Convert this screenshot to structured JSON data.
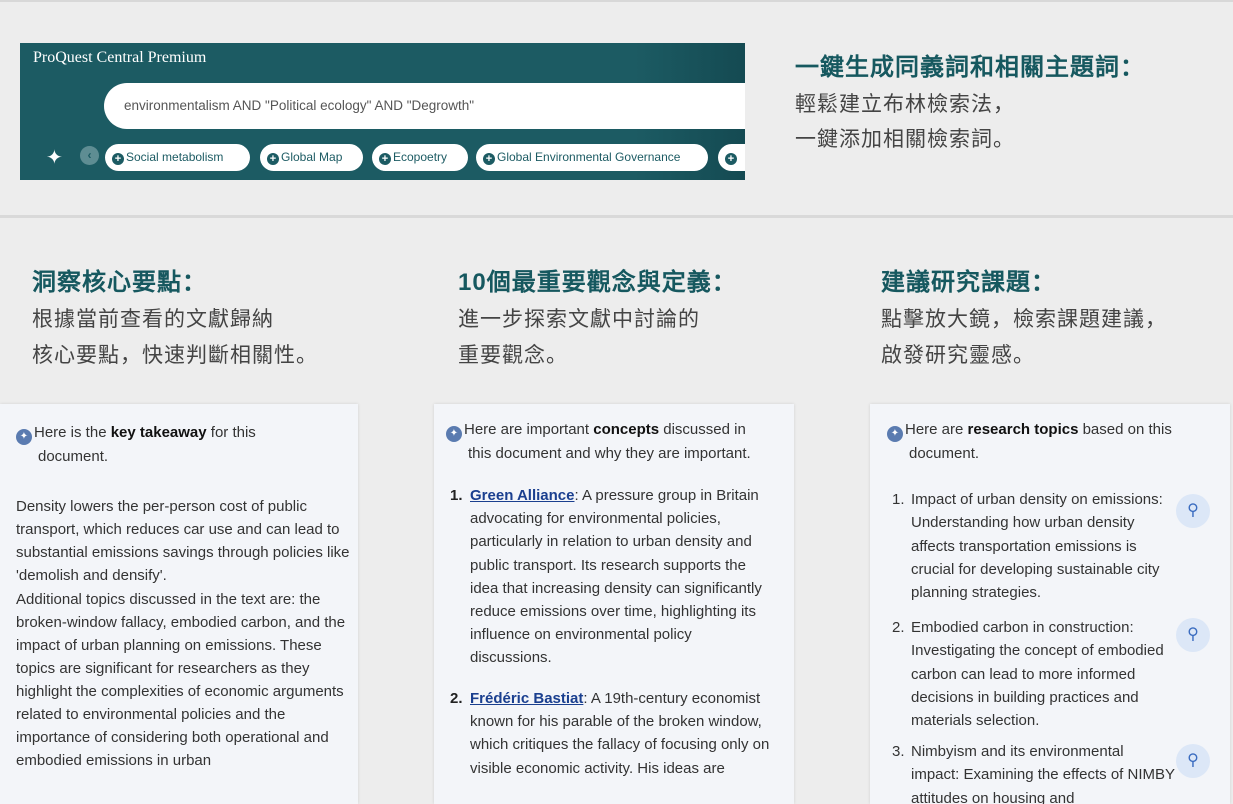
{
  "search_panel": {
    "title": "ProQuest Central Premium",
    "query": "environmentalism AND \"Political ecology\" AND \"Degrowth\"",
    "chips": [
      "Social metabolism",
      "Global Map",
      "Ecopoetry",
      "Global Environmental Governance",
      ""
    ]
  },
  "features": {
    "synonyms": {
      "title": "一鍵生成同義詞和相關主題詞：",
      "desc1": "輕鬆建立布林檢索法，",
      "desc2": "一鍵添加相關檢索詞。"
    },
    "takeaway": {
      "title": "洞察核心要點：",
      "desc1": "根據當前查看的文獻歸納",
      "desc2": "核心要點，快速判斷相關性。"
    },
    "concepts": {
      "title": "10個最重要觀念與定義：",
      "desc1": "進一步探索文獻中討論的",
      "desc2": "重要觀念。"
    },
    "topics": {
      "title": "建議研究課題：",
      "desc1": "點擊放大鏡，檢索課題建議，",
      "desc2": "啟發研究靈感。"
    }
  },
  "takeaway_card": {
    "intro_before": "Here is the ",
    "intro_bold": "key takeaway",
    "intro_after": " for this",
    "intro_line2": "document.",
    "para1": "Density lowers the per-person cost of public transport, which reduces car use and can lead to substantial emissions savings through policies like 'demolish and densify'.",
    "para2": "Additional topics discussed in the text are: the broken-window fallacy, embodied carbon, and the impact of urban planning on emissions. These topics are significant for researchers as they highlight the complexities of economic arguments related to environmental policies and the importance of considering both operational and embodied emissions in urban"
  },
  "concepts_card": {
    "intro_before": "Here are important ",
    "intro_bold": "concepts",
    "intro_after": " discussed in",
    "intro_line2": "this document and why they are important.",
    "items": [
      {
        "num": "1.",
        "term": "Green Alliance",
        "text": ": A pressure group in Britain advocating for environmental policies, particularly in relation to urban density and public transport. Its research supports the idea that increasing density can significantly reduce emissions over time, highlighting its influence on environmental policy discussions."
      },
      {
        "num": "2.",
        "term": "Frédéric Bastiat",
        "text": ": A 19th-century economist known for his parable of the broken window, which critiques the fallacy of focusing only on visible economic activity. His ideas are"
      }
    ]
  },
  "topics_card": {
    "intro_before": "Here are ",
    "intro_bold": "research topics",
    "intro_after": " based on this",
    "intro_line2": "document.",
    "items": [
      {
        "num": "1.",
        "text": "Impact of urban density on emissions: Understanding how urban density affects transportation emissions is crucial for developing sustainable city planning strategies."
      },
      {
        "num": "2.",
        "text": "Embodied carbon in construction: Investigating the concept of embodied carbon can lead to more informed decisions in building practices and materials selection."
      },
      {
        "num": "3.",
        "text": "Nimbyism and its environmental impact: Examining the effects of NIMBY attitudes on housing and"
      }
    ]
  }
}
